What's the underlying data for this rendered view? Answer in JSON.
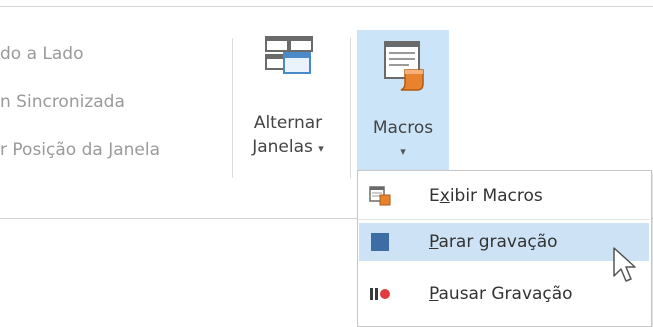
{
  "window_group": {
    "side_by_side": "do a Lado",
    "sync_scroll": "n Sincronizada",
    "reset_position": "r Posição da Janela"
  },
  "switch_windows": {
    "line1": "Alternar",
    "line2": "Janelas",
    "arrow": "▾"
  },
  "macros": {
    "label": "Macros",
    "arrow": "▾",
    "menu": [
      {
        "pre": "E",
        "accel": "x",
        "post": "ibir Macros",
        "icon": "view-macros-icon"
      },
      {
        "pre": "",
        "accel": "P",
        "post": "arar gravação",
        "icon": "stop-recording-icon"
      },
      {
        "pre": "",
        "accel": "P",
        "post": "ausar Gravação",
        "icon": "pause-recording-icon"
      }
    ]
  },
  "colors": {
    "highlight": "#cce4f7",
    "stop_square": "#3c6ea5",
    "record_dot": "#e03c3c",
    "macro_orange": "#e8822e"
  }
}
